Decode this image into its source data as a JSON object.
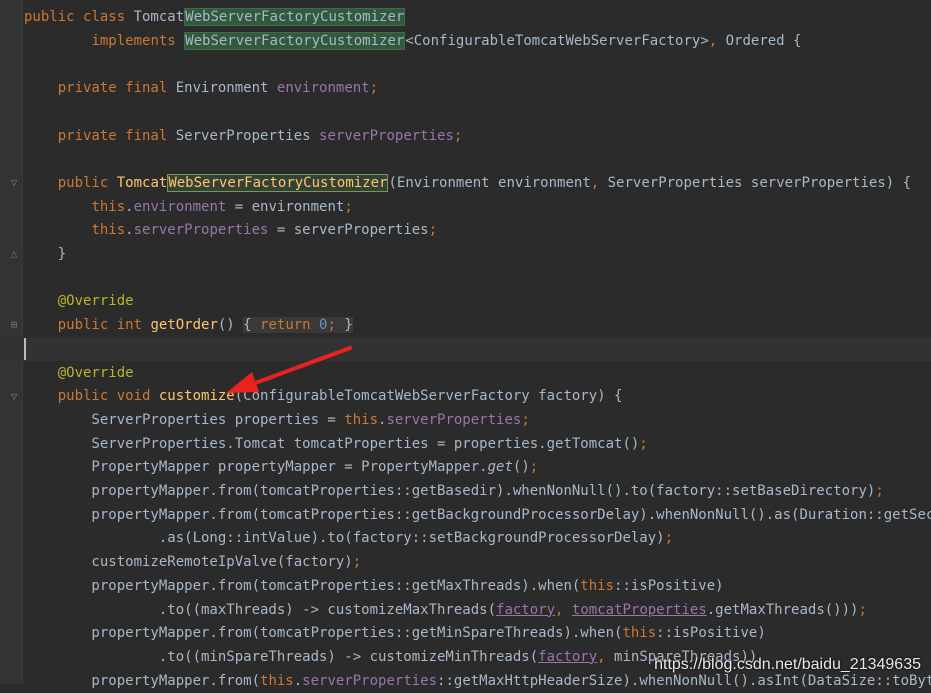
{
  "editor": {
    "lines": [
      [
        {
          "t": "public class ",
          "c": "kw"
        },
        {
          "t": "Tomcat"
        },
        {
          "t": "WebServerFactoryCustomizer",
          "c": "hl"
        }
      ],
      [
        {
          "t": "        "
        },
        {
          "t": "implements ",
          "c": "kw"
        },
        {
          "t": "WebServerFactoryCustomizer",
          "c": "hl"
        },
        {
          "t": "<ConfigurableTomcatWebServerFactory>"
        },
        {
          "t": ", ",
          "c": "pn"
        },
        {
          "t": "Ordered {"
        }
      ],
      [],
      [
        {
          "t": "    "
        },
        {
          "t": "private final ",
          "c": "kw"
        },
        {
          "t": "Environment "
        },
        {
          "t": "environment",
          "c": "fld"
        },
        {
          "t": ";",
          "c": "pn"
        }
      ],
      [],
      [
        {
          "t": "    "
        },
        {
          "t": "private final ",
          "c": "kw"
        },
        {
          "t": "ServerProperties "
        },
        {
          "t": "serverProperties",
          "c": "fld"
        },
        {
          "t": ";",
          "c": "pn"
        }
      ],
      [],
      [
        {
          "t": "    "
        },
        {
          "t": "public ",
          "c": "kw"
        },
        {
          "t": "Tomcat",
          "c": "fn"
        },
        {
          "t": "WebServerFactoryCustomizer",
          "c": "fn hl2"
        },
        {
          "t": "(Environment environment"
        },
        {
          "t": ", ",
          "c": "pn"
        },
        {
          "t": "ServerProperties serverProperties) {"
        }
      ],
      [
        {
          "t": "        "
        },
        {
          "t": "this",
          "c": "kw"
        },
        {
          "t": "."
        },
        {
          "t": "environment",
          "c": "fld"
        },
        {
          "t": " = environment"
        },
        {
          "t": ";",
          "c": "pn"
        }
      ],
      [
        {
          "t": "        "
        },
        {
          "t": "this",
          "c": "kw"
        },
        {
          "t": "."
        },
        {
          "t": "serverProperties",
          "c": "fld"
        },
        {
          "t": " = serverProperties"
        },
        {
          "t": ";",
          "c": "pn"
        }
      ],
      [
        {
          "t": "    }"
        }
      ],
      [],
      [
        {
          "t": "    "
        },
        {
          "t": "@Override",
          "c": "ann"
        }
      ],
      [
        {
          "t": "    "
        },
        {
          "t": "public int ",
          "c": "kw"
        },
        {
          "t": "getOrder",
          "c": "fn"
        },
        {
          "t": "() "
        },
        {
          "t": "{ ",
          "c": "foldbox"
        },
        {
          "t": "return ",
          "c": "kw foldbox"
        },
        {
          "t": "0",
          "c": "num foldbox"
        },
        {
          "t": "; ",
          "c": "pn foldbox"
        },
        {
          "t": "}",
          "c": "foldbox"
        }
      ],
      [],
      [
        {
          "t": "    "
        },
        {
          "t": "@Override",
          "c": "ann"
        }
      ],
      [
        {
          "t": "    "
        },
        {
          "t": "public void ",
          "c": "kw"
        },
        {
          "t": "customize",
          "c": "fn"
        },
        {
          "t": "(ConfigurableTomcatWebServerFactory factory) {"
        }
      ],
      [
        {
          "t": "        ServerProperties properties = "
        },
        {
          "t": "this",
          "c": "kw"
        },
        {
          "t": "."
        },
        {
          "t": "serverProperties",
          "c": "fld"
        },
        {
          "t": ";",
          "c": "pn"
        }
      ],
      [
        {
          "t": "        ServerProperties.Tomcat tomcatProperties = properties.getTomcat()"
        },
        {
          "t": ";",
          "c": "pn"
        }
      ],
      [
        {
          "t": "        PropertyMapper propertyMapper = PropertyMapper."
        },
        {
          "t": "get",
          "c": "it"
        },
        {
          "t": "()"
        },
        {
          "t": ";",
          "c": "pn"
        }
      ],
      [
        {
          "t": "        propertyMapper.from(tomcatProperties::getBasedir).whenNonNull().to(factory::setBaseDirectory)"
        },
        {
          "t": ";",
          "c": "pn"
        }
      ],
      [
        {
          "t": "        propertyMapper.from(tomcatProperties::getBackgroundProcessorDelay).whenNonNull().as(Duration::getSeconds)"
        }
      ],
      [
        {
          "t": "                .as(Long::intValue).to(factory::setBackgroundProcessorDelay)"
        },
        {
          "t": ";",
          "c": "pn"
        }
      ],
      [
        {
          "t": "        customizeRemoteIpValve(factory)"
        },
        {
          "t": ";",
          "c": "pn"
        }
      ],
      [
        {
          "t": "        propertyMapper.from(tomcatProperties::getMaxThreads).when("
        },
        {
          "t": "this",
          "c": "kw"
        },
        {
          "t": "::isPositive)"
        }
      ],
      [
        {
          "t": "                .to((maxThreads) -> customizeMaxThreads("
        },
        {
          "t": "factory",
          "c": "fld ul"
        },
        {
          "t": ", ",
          "c": "pn"
        },
        {
          "t": "tomcatProperties",
          "c": "fld ul"
        },
        {
          "t": ".getMaxThreads()))"
        },
        {
          "t": ";",
          "c": "pn"
        }
      ],
      [
        {
          "t": "        propertyMapper.from(tomcatProperties::getMinSpareThreads).when("
        },
        {
          "t": "this",
          "c": "kw"
        },
        {
          "t": "::isPositive)"
        }
      ],
      [
        {
          "t": "                .to((minSpareThreads) -> customizeMinThreads("
        },
        {
          "t": "factory",
          "c": "fld ul"
        },
        {
          "t": ", ",
          "c": "pn"
        },
        {
          "t": "minSpareThreads))"
        }
      ],
      [
        {
          "t": "        propertyMapper.from("
        },
        {
          "t": "this",
          "c": "kw"
        },
        {
          "t": "."
        },
        {
          "t": "serverProperties",
          "c": "fld"
        },
        {
          "t": "::getMaxHttpHeaderSize).whenNonNull().asInt(DataSize::toBytes)"
        }
      ]
    ]
  },
  "watermark": "https://blog.csdn.net/baidu_21349635"
}
